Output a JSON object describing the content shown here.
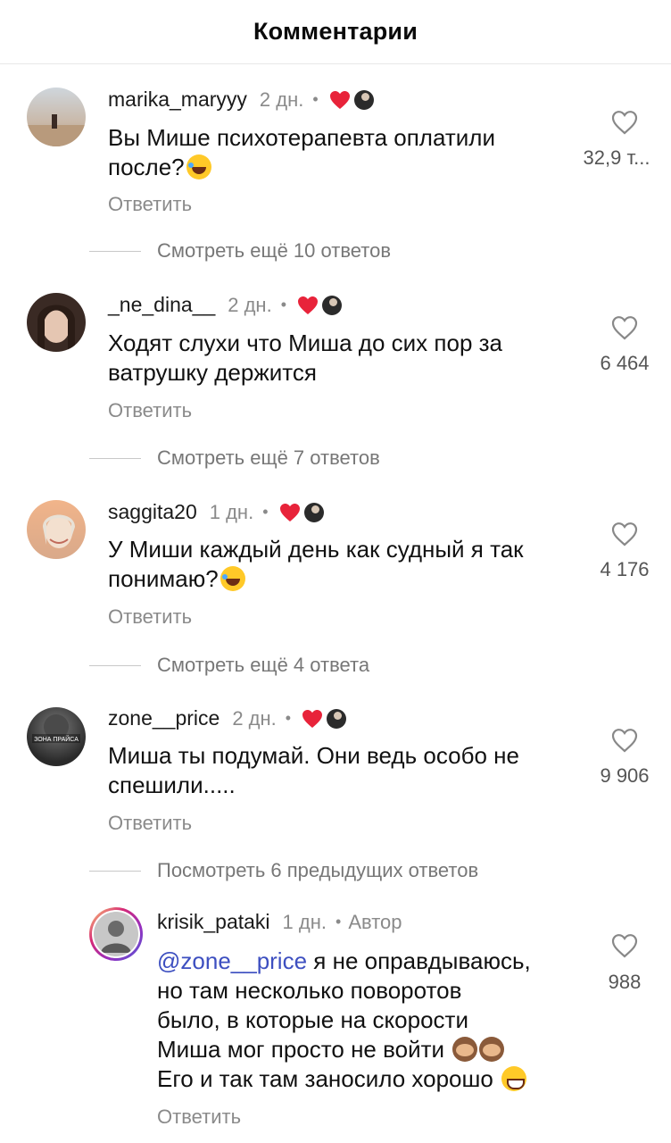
{
  "header": {
    "title": "Комментарии"
  },
  "comments": [
    {
      "username": "marika_maryyy",
      "time": "2 дн.",
      "dot": "•",
      "text": "Вы Мише психотерапевта оплатили после?",
      "emoji": "laugh",
      "reply": "Ответить",
      "likes": "32,9 т...",
      "more": "Смотреть ещё 10 ответов",
      "colors": {
        "avatar_bg": "#c9b8a8"
      }
    },
    {
      "username": "_ne_dina__",
      "time": "2 дн.",
      "dot": "•",
      "text": "Ходят слухи что Миша до сих пор за ватрушку держится",
      "reply": "Ответить",
      "likes": "6 464",
      "more": "Смотреть ещё 7 ответов",
      "colors": {
        "avatar_bg": "#3a2a24"
      }
    },
    {
      "username": "saggita20",
      "time": "1 дн.",
      "dot": "•",
      "text": "У Миши каждый день как судный я так понимаю?",
      "emoji": "laugh",
      "reply": "Ответить",
      "likes": "4 176",
      "more": "Смотреть ещё 4 ответа",
      "colors": {
        "avatar_bg": "#d9a98a"
      }
    },
    {
      "username": "zone__price",
      "time": "2 дн.",
      "dot": "•",
      "text": "Миша ты подумай. Они ведь особо не спешили.....",
      "reply": "Ответить",
      "likes": "9 906",
      "more": "Посмотреть 6 предыдущих ответов",
      "avatar_caption": "ЗОНА ПРАЙСА",
      "colors": {
        "avatar_bg": "#1f1f1f"
      }
    }
  ],
  "reply_comment": {
    "username": "krisik_pataki",
    "time": "1 дн.",
    "dot": "•",
    "author_label": "Автор",
    "mention": "@zone__price",
    "lines": [
      " я не оправдываюсь,",
      "но там несколько поворотов",
      "было, в которые на скорости",
      "Миша мог просто не войти",
      "Его и так там заносило хорошо"
    ],
    "reply": "Ответить",
    "likes": "988",
    "colors": {
      "avatar_ring": "#c13584"
    }
  },
  "icons": {
    "like": "heart-outline-icon",
    "creator_like": "heart-filled-icon",
    "creator_avatar": "creator-avatar-icon"
  },
  "colors": {
    "heart_red": "#e8233a",
    "mention_blue": "#3d4fc0",
    "muted_gray": "#8a8a8a"
  }
}
